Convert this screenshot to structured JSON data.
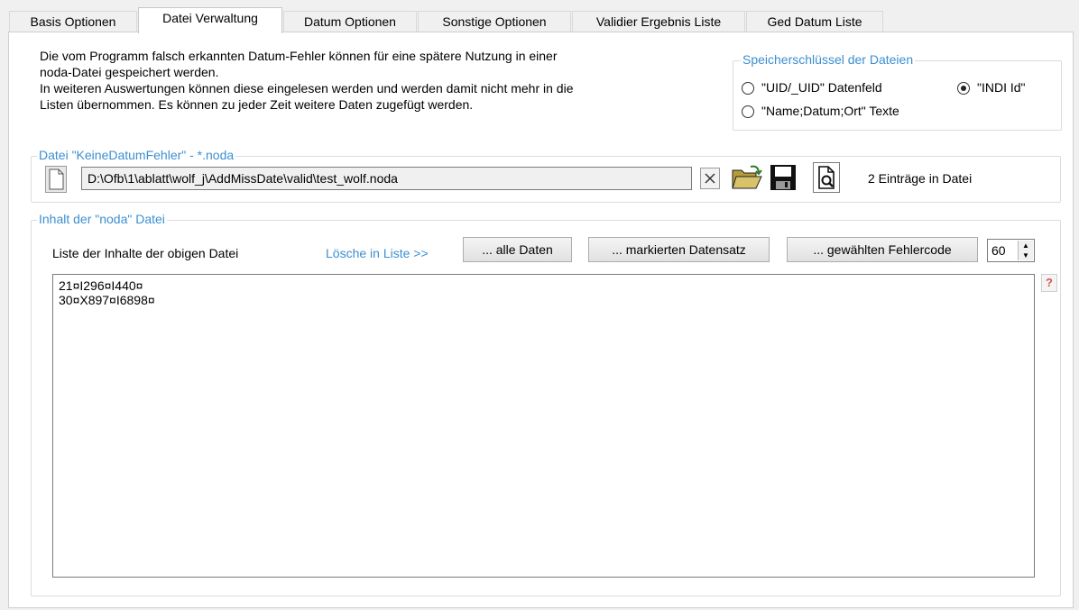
{
  "tabs": [
    {
      "label": "Basis Optionen"
    },
    {
      "label": "Datei Verwaltung"
    },
    {
      "label": "Datum Optionen"
    },
    {
      "label": "Sonstige Optionen"
    },
    {
      "label": "Validier Ergebnis Liste"
    },
    {
      "label": "Ged Datum Liste"
    }
  ],
  "active_tab": "Datei Verwaltung",
  "description": {
    "line1": "Die vom Programm falsch erkannten Datum-Fehler können für eine spätere Nutzung in einer",
    "line2": "noda-Datei gespeichert werden.",
    "line3": "In weiteren Auswertungen können diese eingelesen werden und werden damit nicht mehr in die",
    "line4": "Listen übernommen. Es können zu jeder Zeit weitere Daten zugefügt werden."
  },
  "key_group": {
    "title": "Speicherschlüssel der Dateien",
    "options": [
      {
        "label": "\"UID/_UID\" Datenfeld",
        "selected": false
      },
      {
        "label": "\"INDI Id\"",
        "selected": true
      },
      {
        "label": "\"Name;Datum;Ort\" Texte",
        "selected": false
      }
    ]
  },
  "file_group": {
    "title": "Datei \"KeineDatumFehler\" - *.noda",
    "path": "D:\\Ofb\\1\\ablatt\\wolf_j\\AddMissDate\\valid\\test_wolf.noda",
    "entries_info": "2 Einträge in Datei"
  },
  "content_group": {
    "title": "Inhalt der \"noda\" Datei",
    "list_label": "Liste der Inhalte der obigen Datei",
    "delete_label": "Lösche in Liste >>",
    "btn_all": "... alle Daten",
    "btn_marked": "... markierten Datensatz",
    "btn_errorcode": "... gewählten Fehlercode",
    "errorcode_value": "60",
    "list_items": [
      "21¤I296¤I440¤",
      "30¤X897¤I6898¤"
    ],
    "help_symbol": "?"
  },
  "colors": {
    "accent": "#3c8fd0",
    "help": "#d9534f"
  }
}
